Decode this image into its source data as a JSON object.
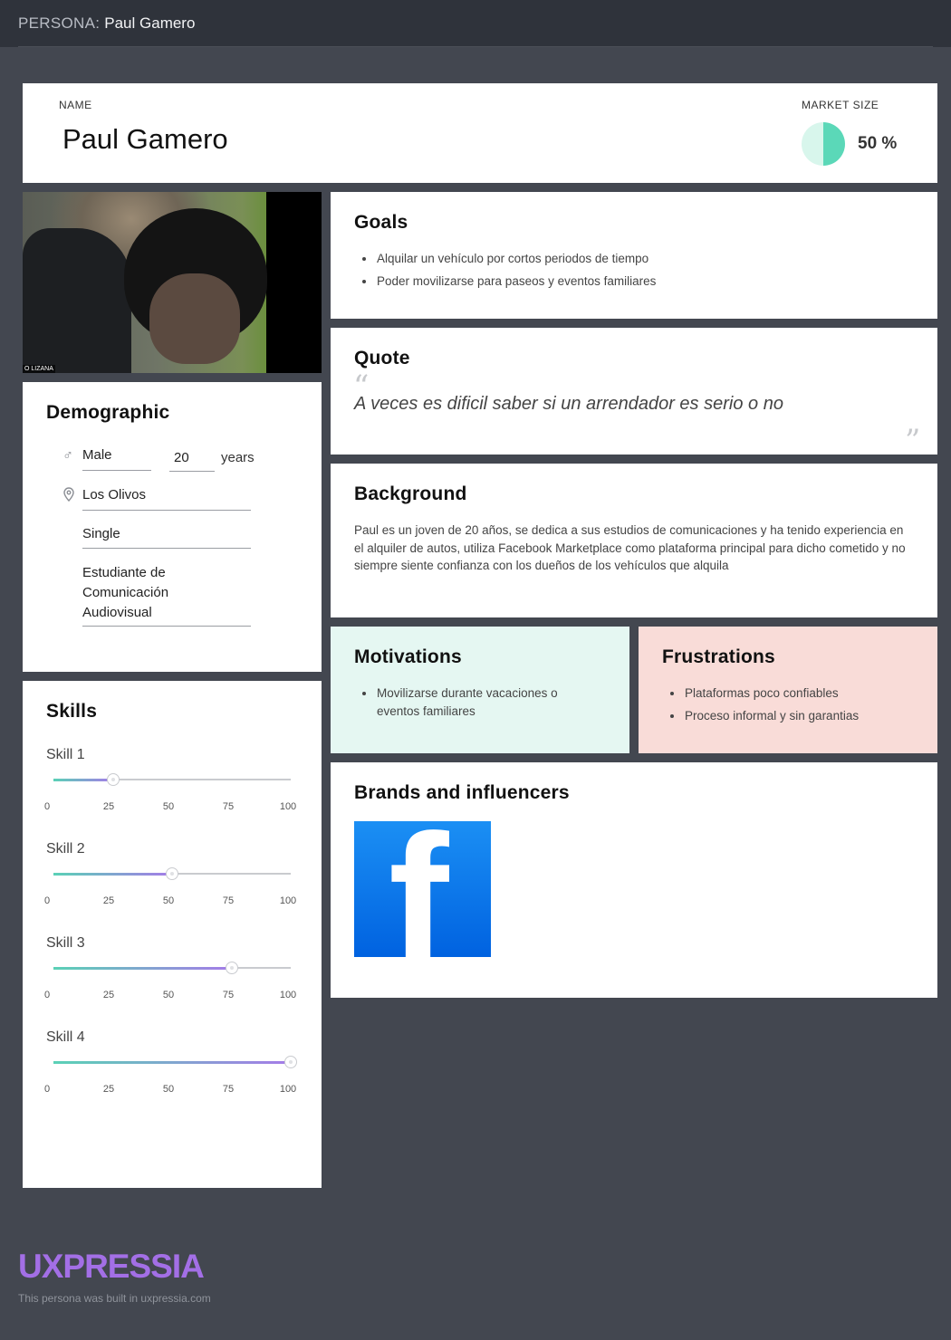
{
  "topbar": {
    "label": "PERSONA:",
    "name": "Paul Gamero"
  },
  "header": {
    "name_label": "NAME",
    "name": "Paul Gamero",
    "market_label": "MARKET SIZE",
    "market_value": "50 %",
    "market_fraction": 0.5,
    "colors": {
      "pie_light": "#d8f6ec",
      "pie_dark": "#5bd8b8"
    }
  },
  "photo": {
    "caption": "O LIZANA"
  },
  "demographic": {
    "title": "Demographic",
    "gender": "Male",
    "age": "20",
    "age_unit": "years",
    "location": "Los Olivos",
    "status": "Single",
    "occupation_lines": [
      "Estudiante de",
      "Comunicación",
      "Audiovisual"
    ]
  },
  "skills": {
    "title": "Skills",
    "ticks": [
      "0",
      "25",
      "50",
      "75",
      "100"
    ],
    "items": [
      {
        "name": "Skill 1",
        "value": 25
      },
      {
        "name": "Skill 2",
        "value": 50
      },
      {
        "name": "Skill 3",
        "value": 75
      },
      {
        "name": "Skill 4",
        "value": 100
      }
    ]
  },
  "goals": {
    "title": "Goals",
    "items": [
      "Alquilar un vehículo por cortos periodos de tiempo",
      "Poder movilizarse para paseos y eventos familiares"
    ]
  },
  "quote": {
    "title": "Quote",
    "open_mark": "“",
    "close_mark": "”",
    "text": "A veces es dificil saber si un arrendador es serio o no"
  },
  "background": {
    "title": "Background",
    "text": "Paul es un joven de 20 años, se dedica a sus estudios de comunicaciones y ha tenido experiencia en el alquiler de autos, utiliza Facebook Marketplace como plataforma principal para dicho cometido y no siempre siente confianza con los dueños de los vehículos que alquila"
  },
  "motivations": {
    "title": "Motivations",
    "items": [
      "Movilizarse durante vacaciones o eventos familiares"
    ]
  },
  "frustrations": {
    "title": "Frustrations",
    "items": [
      "Plataformas poco confiables",
      "Proceso informal y sin garantias"
    ]
  },
  "brands": {
    "title": "Brands and influencers",
    "logo_letter": "f"
  },
  "footer": {
    "logo": "UXPRESSIA",
    "note": "This persona was built in uxpressia.com"
  }
}
